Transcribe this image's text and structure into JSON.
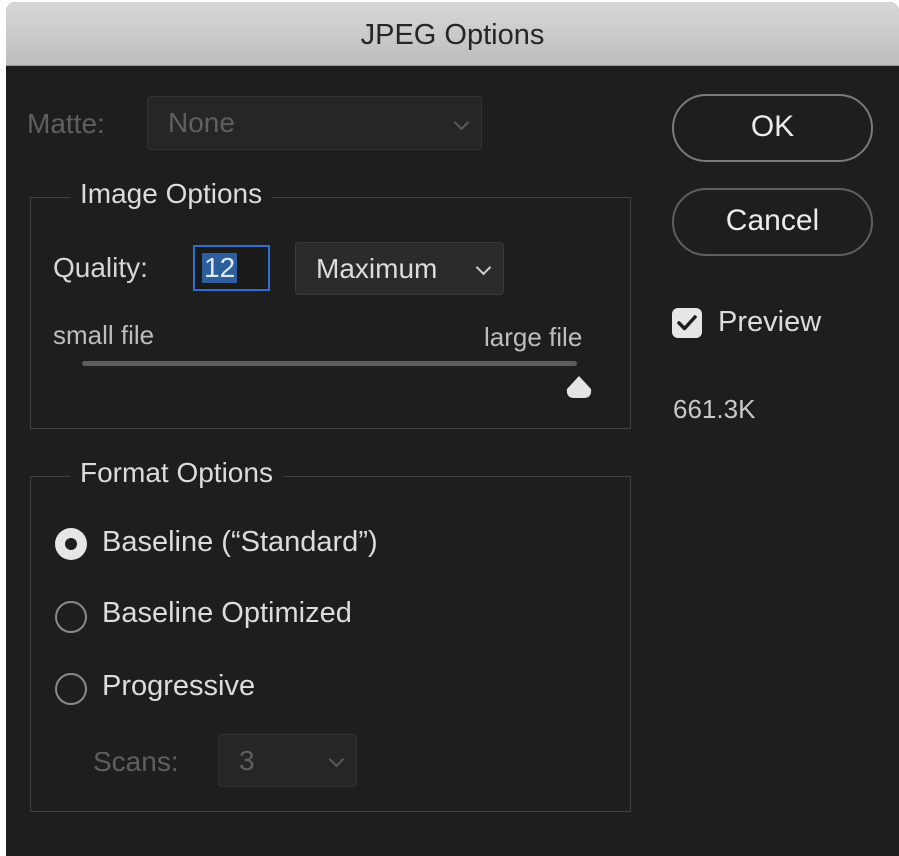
{
  "window": {
    "title": "JPEG Options"
  },
  "matte": {
    "label": "Matte:",
    "value": "None"
  },
  "image_options": {
    "title": "Image Options",
    "quality_label": "Quality:",
    "quality_value": "12",
    "quality_preset": "Maximum",
    "small_label": "small file",
    "large_label": "large file",
    "slider_fraction": 1.0
  },
  "format_options": {
    "title": "Format Options",
    "options": [
      {
        "label": "Baseline (“Standard”)",
        "selected": true
      },
      {
        "label": "Baseline Optimized",
        "selected": false
      },
      {
        "label": "Progressive",
        "selected": false
      }
    ],
    "scans_label": "Scans:",
    "scans_value": "3"
  },
  "buttons": {
    "ok": "OK",
    "cancel": "Cancel"
  },
  "preview": {
    "label": "Preview",
    "checked": true
  },
  "file_size": "661.3K",
  "colors": {
    "dialog_bg": "#1e1e1e",
    "title_bar": "#c9c9c9",
    "focus_accent": "#2d6fd1",
    "text": "#d6d6d6",
    "disabled_text": "#5f5f5f"
  }
}
